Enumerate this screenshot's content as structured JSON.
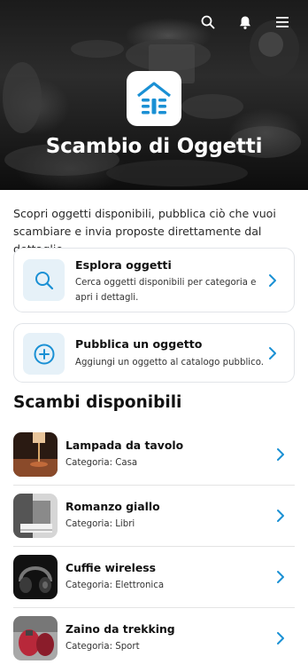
{
  "hero": {
    "title": "Scambio di Oggetti",
    "icons": [
      "search-icon",
      "notification-icon",
      "menu-icon"
    ]
  },
  "intro": {
    "text": "Scopri oggetti disponibili, pubblica ciò che vuoi scambiare e invia proposte direttamente dal dettaglio."
  },
  "actions": [
    {
      "title": "Esplora oggetti",
      "description": "Cerca oggetti disponibili per categoria e apri i dettagli.",
      "icon": "search-icon"
    },
    {
      "title": "Pubblica un oggetto",
      "description": "Aggiungi un oggetto al catalogo pubblico.",
      "icon": "add-circle-icon"
    }
  ],
  "section": {
    "title": "Scambi disponibili"
  },
  "items": [
    {
      "title": "Lampada da tavolo",
      "category": "Categoria: Casa"
    },
    {
      "title": "Romanzo giallo",
      "category": "Categoria: Libri"
    },
    {
      "title": "Cuffie wireless",
      "category": "Categoria: Elettronica"
    },
    {
      "title": "Zaino da trekking",
      "category": "Categoria: Sport"
    }
  ],
  "colors": {
    "accent": "#1a90d4",
    "tile_bg": "#e6f1f8",
    "card_border": "#e1e4e8"
  }
}
